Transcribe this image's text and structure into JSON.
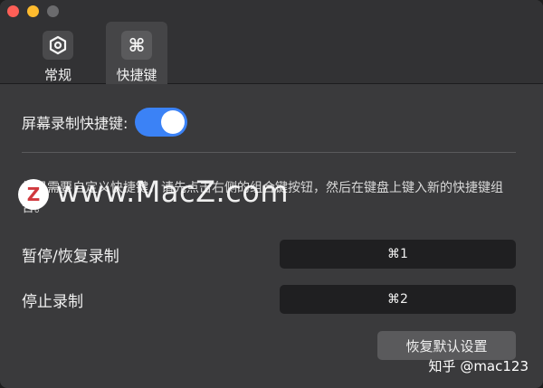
{
  "window": {
    "traffic_lights": [
      "close",
      "minimize",
      "zoom"
    ]
  },
  "tabs": [
    {
      "label": "常规",
      "icon": "settings-hex-icon",
      "selected": false
    },
    {
      "label": "快捷键",
      "icon": "command-key-icon",
      "glyph": "⌘",
      "selected": true
    }
  ],
  "settings": {
    "toggle_label": "屏幕录制快捷键:",
    "toggle_on": true,
    "description": "如果需要自定义快捷键，请先点击右侧的组合键按钮，然后在键盘上键入新的快捷键组合。",
    "shortcuts": [
      {
        "label": "暂停/恢复录制",
        "key": "⌘1"
      },
      {
        "label": "停止录制",
        "key": "⌘2"
      }
    ],
    "reset_label": "恢复默认设置"
  },
  "watermark": {
    "logo_letter": "Z",
    "site": "www.MacZ.com",
    "credit": "知乎 @mac123"
  },
  "colors": {
    "accent": "#3b82f6",
    "background": "#3a3a3c",
    "key_field": "#1f1f21"
  }
}
